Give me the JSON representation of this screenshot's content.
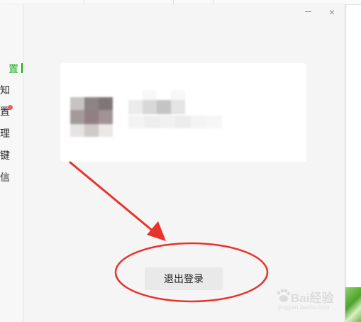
{
  "window": {
    "minimize_icon": "minimize-icon",
    "close_icon": "close-icon",
    "close_glyph": "×"
  },
  "sidebar": {
    "items": [
      {
        "label": "置",
        "active": true,
        "badge": false
      },
      {
        "label": "知",
        "active": false,
        "badge": false
      },
      {
        "label": "置",
        "active": false,
        "badge": true
      },
      {
        "label": "理",
        "active": false,
        "badge": false
      },
      {
        "label": "键",
        "active": false,
        "badge": false
      },
      {
        "label": "信",
        "active": false,
        "badge": false
      }
    ]
  },
  "account": {
    "avatar": "blurred-avatar",
    "name": "blurred-account-name"
  },
  "logout": {
    "label": "退出登录"
  },
  "annotation": {
    "arrow_color": "#e8322c",
    "ellipse_color": "#e8322c"
  },
  "watermark": {
    "text": "Bai经验",
    "sub": "jingyan.baidu.com"
  },
  "colors": {
    "accent": "#1aad19",
    "badge": "#f25d5d",
    "window_bg": "#f5f5f5",
    "card_bg": "#ffffff",
    "button_bg": "#e9e9e9"
  }
}
